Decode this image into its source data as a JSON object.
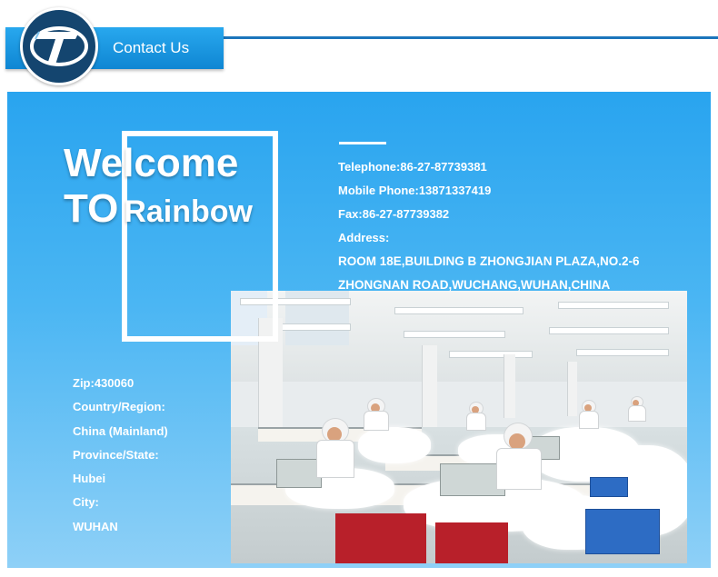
{
  "header": {
    "title": "Contact Us",
    "logo_icon": "rainbow-t-logo-icon",
    "colors": {
      "line": "#1b75bb",
      "tab": "#0f86d3",
      "logo_bg": "#14456f"
    }
  },
  "banner": {
    "welcome": "Welcome",
    "to": "TO",
    "brand": "Rainbow",
    "background": "#29a4ef",
    "contact": {
      "telephone": "Telephone:86-27-87739381",
      "mobile": "Mobile Phone:13871337419",
      "fax": "Fax:86-27-87739382",
      "address_label": "Address:",
      "address_line1": "ROOM 18E,BUILDING B ZHONGJIAN PLAZA,NO.2-6",
      "address_line2": "ZHONGNAN ROAD,WUCHANG,WUHAN,CHINA"
    },
    "info": {
      "zip": "Zip:430060",
      "country_label": "Country/Region:",
      "country": "China (Mainland)",
      "province_label": "Province/State:",
      "province": "Hubei",
      "city_label": "City:",
      "city": "WUHAN"
    },
    "photo_subject": "factory-workshop-photo"
  }
}
